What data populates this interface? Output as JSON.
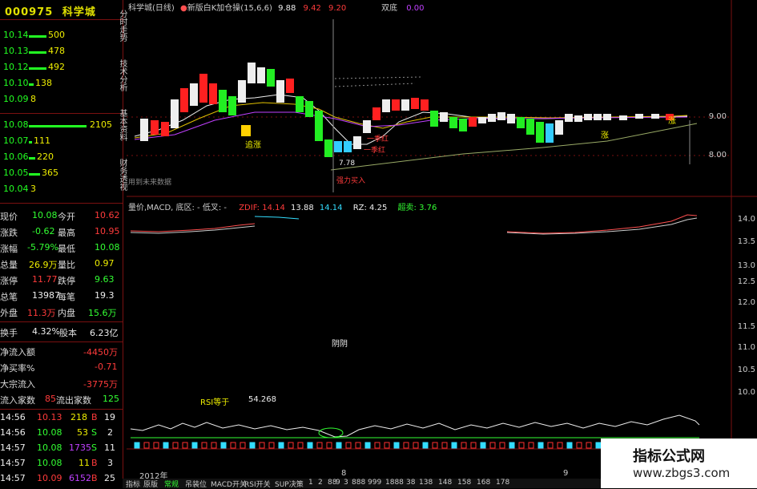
{
  "stock": {
    "code": "000975",
    "name": "科学城"
  },
  "asks": [
    {
      "price": "10.14",
      "vol": "500"
    },
    {
      "price": "10.13",
      "vol": "478"
    },
    {
      "price": "10.12",
      "vol": "492"
    },
    {
      "price": "10.10",
      "vol": "138"
    },
    {
      "price": "10.09",
      "vol": "8"
    }
  ],
  "bids": [
    {
      "price": "10.08",
      "vol": "2105"
    },
    {
      "price": "10.07",
      "vol": "111"
    },
    {
      "price": "10.06",
      "vol": "220"
    },
    {
      "price": "10.05",
      "vol": "365"
    },
    {
      "price": "10.04",
      "vol": "3"
    }
  ],
  "quote": [
    {
      "l1": "现价",
      "v1": "10.08",
      "l2": "今开",
      "v2": "10.62"
    },
    {
      "l1": "涨跌",
      "v1": "-0.62",
      "l2": "最高",
      "v2": "10.95"
    },
    {
      "l1": "涨幅",
      "v1": "-5.79%",
      "l2": "最低",
      "v2": "10.08"
    },
    {
      "l1": "总量",
      "v1": "26.9万",
      "l2": "量比",
      "v2": "0.97"
    },
    {
      "l1": "涨停",
      "v1": "11.77",
      "l2": "跌停",
      "v2": "9.63"
    },
    {
      "l1": "总笔",
      "v1": "13987",
      "l2": "每笔",
      "v2": "19.3"
    },
    {
      "l1": "外盘",
      "v1": "11.3万",
      "l2": "内盘",
      "v2": "15.6万"
    }
  ],
  "turnover": {
    "l1": "换手",
    "v1": "4.32%",
    "l2": "股本",
    "v2": "6.23亿"
  },
  "flow": [
    {
      "l": "净流入额",
      "v": "-4450万"
    },
    {
      "l": "净买率%",
      "v": "-0.71"
    },
    {
      "l": "大宗流入",
      "v": "-3775万"
    }
  ],
  "inout": {
    "l1": "流入家数",
    "v1": "85",
    "l2": "流出家数",
    "v2": "125"
  },
  "ticks": [
    {
      "t": "14:56",
      "p": "10.13",
      "v": "218",
      "s": "B",
      "n": "19"
    },
    {
      "t": "14:56",
      "p": "10.08",
      "v": "53",
      "s": "S",
      "n": "2"
    },
    {
      "t": "14:57",
      "p": "10.08",
      "v": "1735",
      "s": "S",
      "n": "11"
    },
    {
      "t": "14:57",
      "p": "10.08",
      "v": "11",
      "s": "B",
      "n": "3"
    },
    {
      "t": "14:57",
      "p": "10.09",
      "v": "6152",
      "s": "B",
      "n": "25"
    }
  ],
  "vtools": [
    "分时走势",
    "技术分析",
    "基本资料",
    "财务透视"
  ],
  "chart_header": {
    "name": "科学城(日线)",
    "indicator": "新版白K加仓操(15,6,6)",
    "v1": "9.88",
    "v2": "9.42",
    "v3": "9.20",
    "dual": "双底",
    "dual_v": "0.00"
  },
  "macd_header": {
    "label": "量价,MACD, 底区: - 低叉: -",
    "zdif": "ZDIF: 14.14",
    "a": "13.88",
    "b": "14.14",
    "rz": "RZ: 4.25",
    "cs": "超卖: 3.76"
  },
  "annotations": {
    "chase": "追涨",
    "low": "7.78",
    "red1": "一季红",
    "red2": "一季红",
    "buy": "强力买入",
    "rise": "涨",
    "hidden": "用到未来数据",
    "yin": "阴阴",
    "rsi": "RSI等于",
    "rsi_v": "54.268"
  },
  "price_axis": [
    "9.00",
    "8.00"
  ],
  "macd_axis": [
    "14.0",
    "13.5",
    "13.0",
    "12.5",
    "12.0",
    "11.5",
    "11.0",
    "10.5",
    "10.0"
  ],
  "bottom_year": "2012年",
  "bottom_mid": "8",
  "bottom_right": "9",
  "bottom_tabs": [
    "指标",
    "原版",
    "常规",
    "吊装位",
    "MACD开关",
    "RSI开关",
    "SUP决策",
    "1",
    "2",
    "88",
    "9",
    "3",
    "888",
    "999",
    "1888",
    "38",
    "138",
    "148",
    "158",
    "168",
    "178"
  ],
  "watermark": {
    "title": "指标公式网",
    "url": "www.zbgs3.com"
  },
  "colors": {
    "up": "#ff3b3b",
    "down": "#33ff33",
    "accent": "#eeee00",
    "cyan": "#33ddff"
  }
}
